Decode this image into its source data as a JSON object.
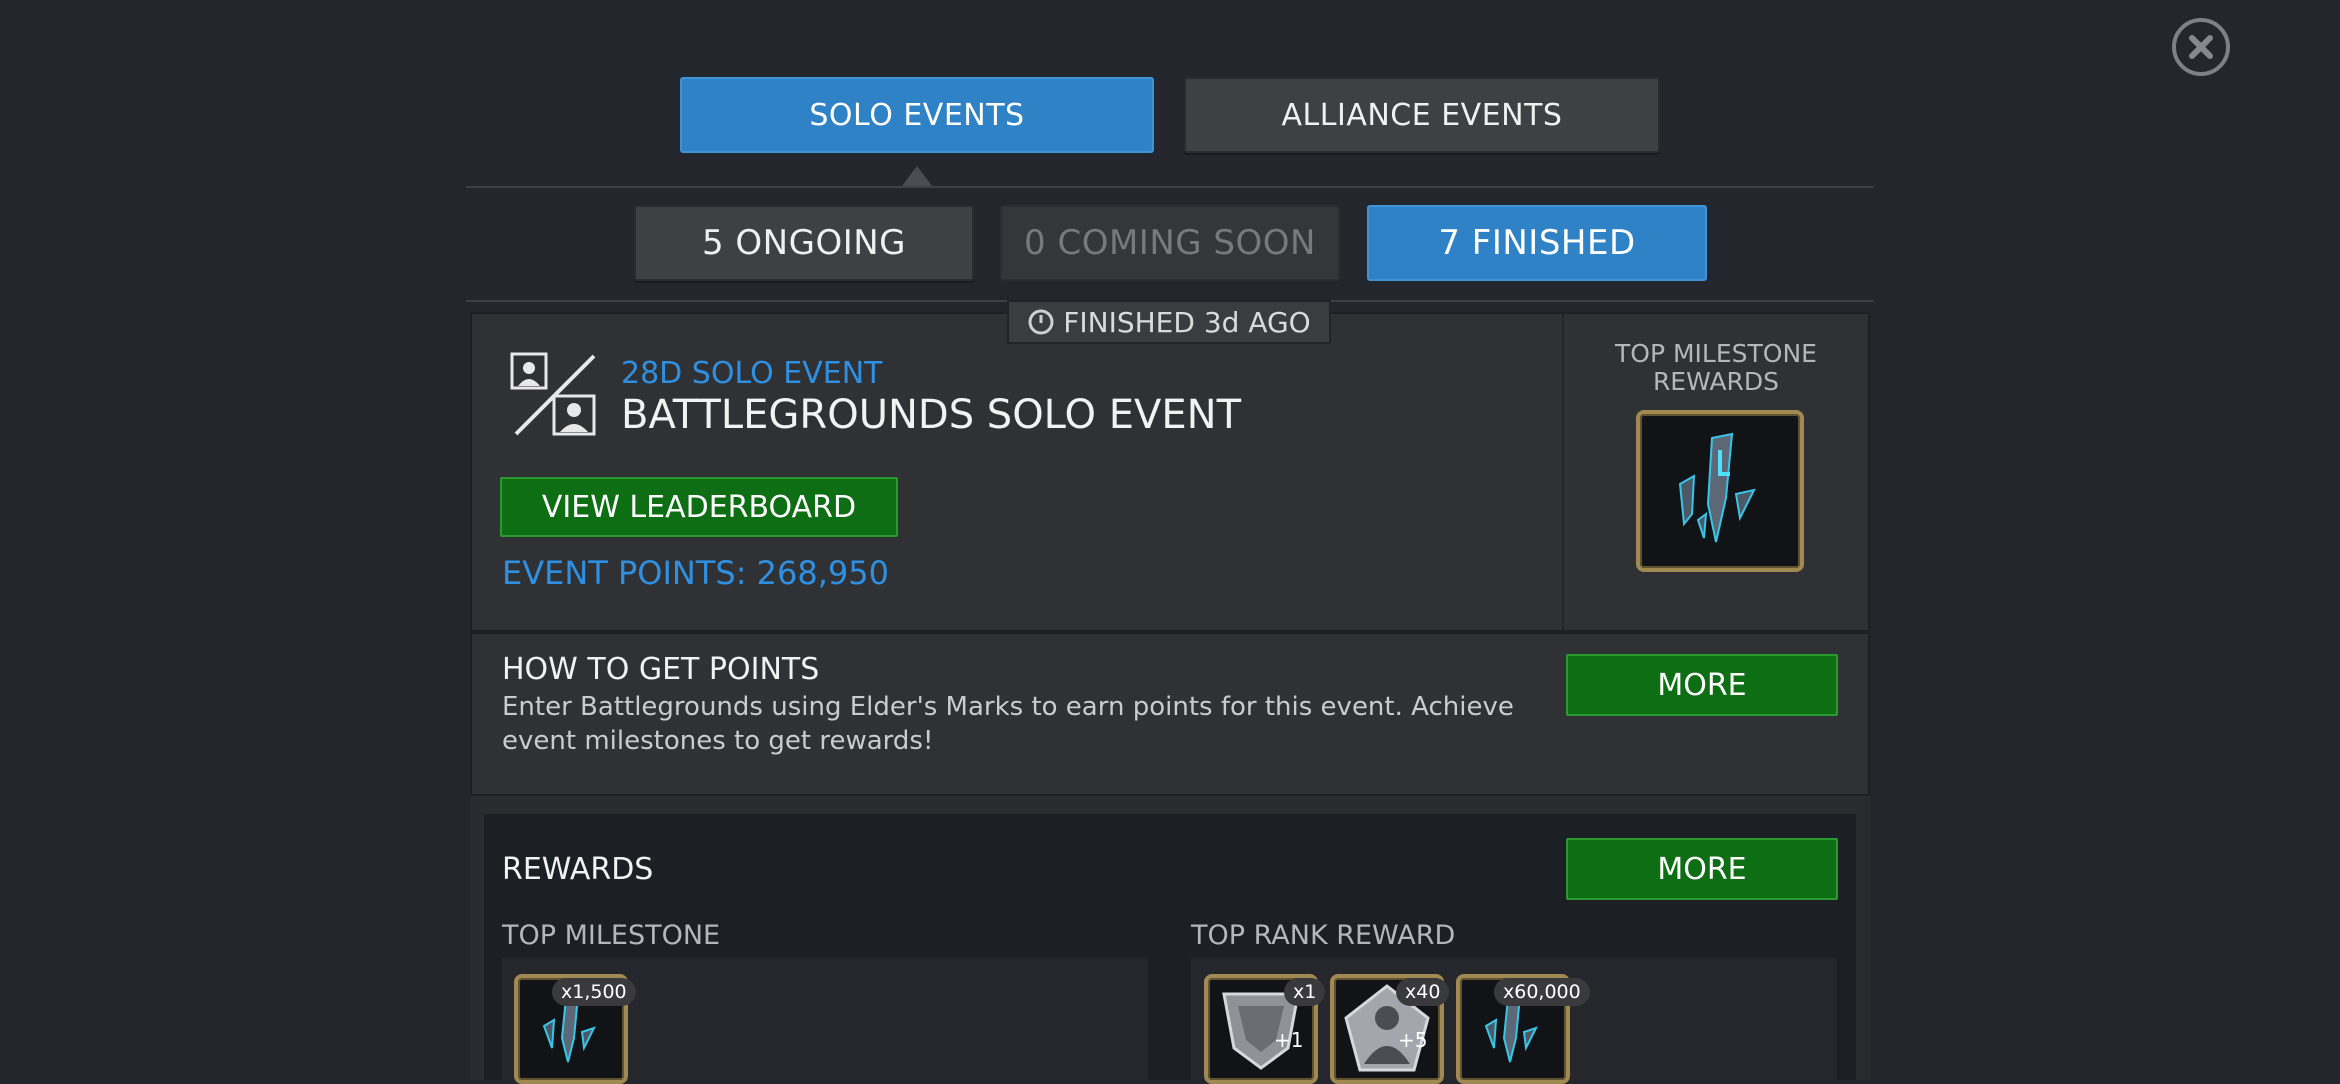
{
  "tabs": {
    "solo": "SOLO EVENTS",
    "alliance": "ALLIANCE EVENTS"
  },
  "filters": {
    "ongoing": "5 ONGOING",
    "coming_soon": "0 COMING SOON",
    "finished": "7 FINISHED"
  },
  "event": {
    "status": "FINISHED 3d AGO",
    "subtitle": "28D SOLO EVENT",
    "title": "BATTLEGROUNDS SOLO EVENT",
    "leaderboard_button": "VIEW LEADERBOARD",
    "points": "EVENT POINTS: 268,950",
    "top_milestone_rewards_line1": "TOP MILESTONE",
    "top_milestone_rewards_line2": "REWARDS"
  },
  "how_to": {
    "heading": "HOW TO GET POINTS",
    "text_line1": "Enter Battlegrounds using Elder's Marks to earn points for this event. Achieve",
    "text_line2": "event milestones to get rewards!",
    "more_button": "MORE"
  },
  "rewards": {
    "heading": "REWARDS",
    "more_button": "MORE",
    "top_milestone_label": "TOP MILESTONE",
    "top_rank_label": "TOP RANK REWARD",
    "milestone_items": [
      {
        "qty": "x1,500",
        "icon": "shard-crystal-icon"
      }
    ],
    "rank_items": [
      {
        "qty": "x1",
        "badge": "+1",
        "icon": "shield-crystal-icon"
      },
      {
        "qty": "x40",
        "badge": "+5",
        "icon": "champion-crystal-icon"
      },
      {
        "qty": "x60,000",
        "icon": "shard-crystal-icon"
      }
    ]
  },
  "colors": {
    "accent_blue": "#2f82c6",
    "points_blue": "#2f8fe0",
    "green": "#0e6e14",
    "gold_frame": "#a08a52"
  }
}
